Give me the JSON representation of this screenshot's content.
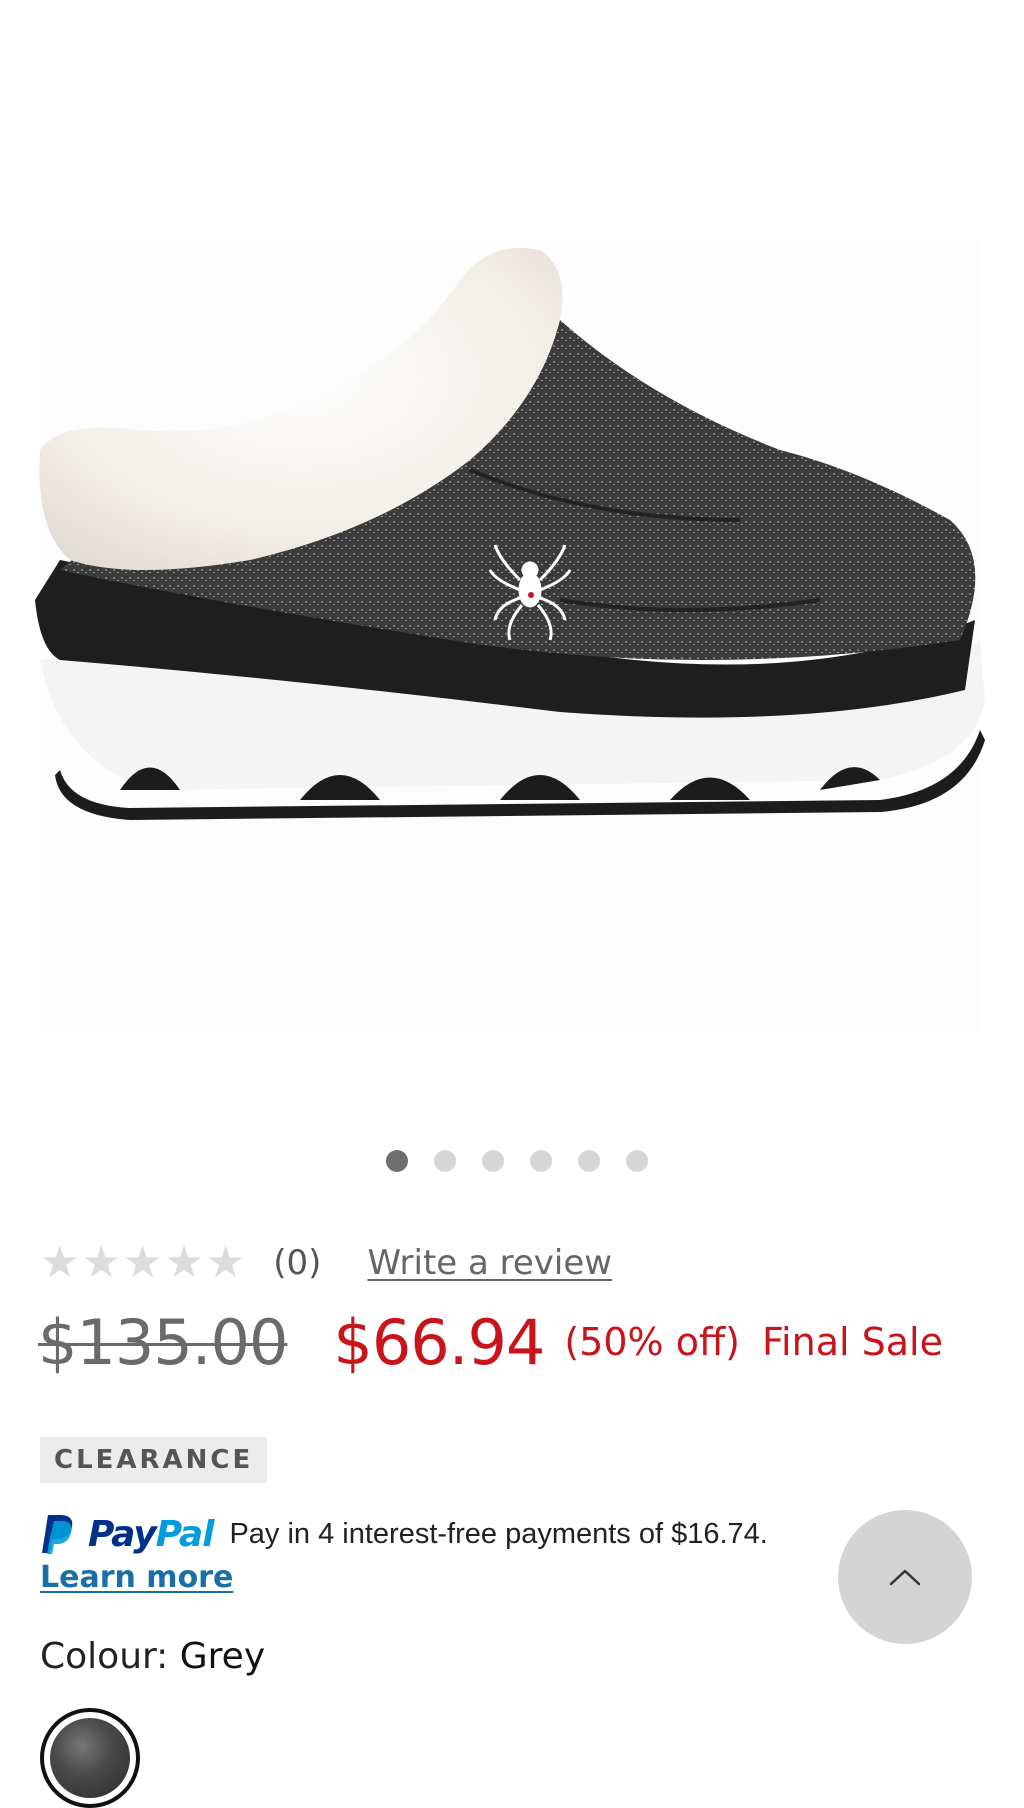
{
  "product": {
    "image_alt": "Grey knit slip-on clog with white faux fur collar",
    "gallery_count": 6,
    "gallery_active_index": 0
  },
  "rating": {
    "stars_filled": 0,
    "stars_total": 5,
    "review_count": "(0)",
    "write_review_label": "Write a review"
  },
  "price": {
    "original": "$135.00",
    "sale": "$66.94",
    "discount": "(50% off)",
    "final_sale": "Final Sale"
  },
  "badge": {
    "label": "CLEARANCE"
  },
  "paypal": {
    "brand_pay": "Pay",
    "brand_pal": "Pal",
    "message": "Pay in 4 interest-free payments of $16.74.",
    "learn_more": "Learn more"
  },
  "colour": {
    "label": "Colour:",
    "value": "Grey"
  },
  "icons": {
    "scroll_top": "chevron-up-icon",
    "star": "star-icon",
    "paypal": "paypal-logo-icon"
  },
  "colors": {
    "sale_red": "#c8151b",
    "link_blue": "#1a6fa8",
    "paypal_dark": "#003087",
    "paypal_light": "#009cde"
  }
}
